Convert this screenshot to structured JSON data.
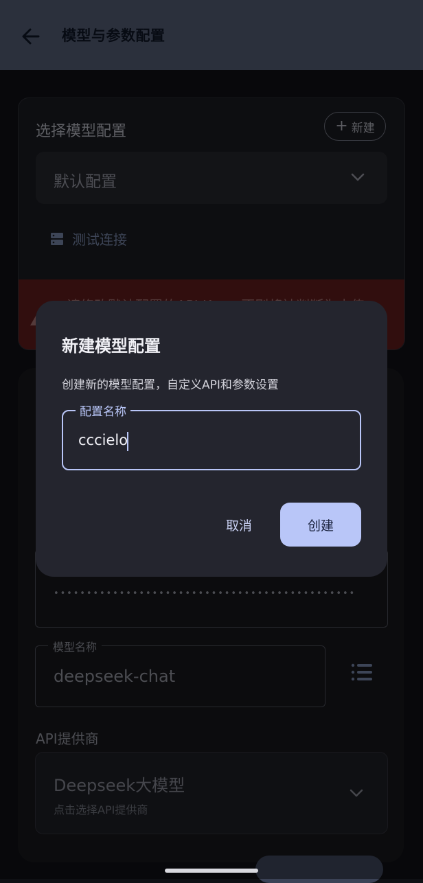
{
  "appbar": {
    "title": "模型与参数配置"
  },
  "config_card": {
    "title": "选择模型配置",
    "new_button": "新建",
    "selected_config": "默认配置",
    "test_connection": "测试连接",
    "warning": "请修改默认配置的API Key，否则将被判断为未传"
  },
  "form": {
    "api_key_masked": "••••••••••••••••••••••••••••••••••••••••••••••",
    "model_label": "模型名称",
    "model_value": "deepseek-chat",
    "provider_label": "API提供商",
    "provider_value": "Deepseek大模型",
    "provider_hint": "点击选择API提供商"
  },
  "dialog": {
    "title": "新建模型配置",
    "description": "创建新的模型配置，自定义API和参数设置",
    "field_label": "配置名称",
    "field_value": "cccielo",
    "cancel": "取消",
    "create": "创建"
  }
}
